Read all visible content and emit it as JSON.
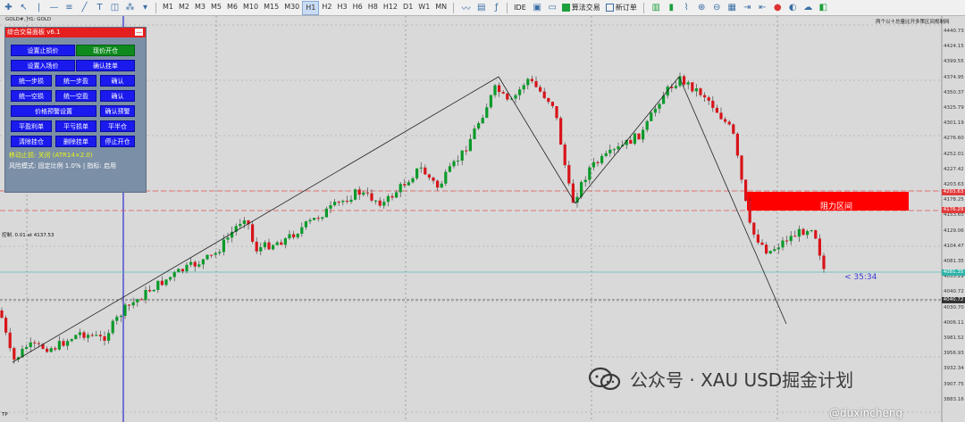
{
  "toolbar": {
    "timeframes": [
      "M1",
      "M2",
      "M3",
      "M5",
      "M6",
      "M10",
      "M15",
      "M30",
      "H1",
      "H2",
      "H3",
      "H6",
      "H8",
      "H12",
      "D1",
      "W1",
      "MN"
    ],
    "active_timeframe": "H1",
    "ide_label": "IDE",
    "algo_label": "算法交易",
    "new_order_label": "新订单"
  },
  "chart": {
    "symbol": "GOLD#, H1: GOLD",
    "top_right_text": "两个以十总量比开多策区间规制网",
    "ctrl_label": "控制. 0.01 at 4137.53",
    "tp_label": "TP",
    "resistance_label": "阻力区间",
    "timer_label": "< 35:34",
    "price_labels": [
      "4440.73",
      "4424.15",
      "4399.55",
      "4374.95",
      "4350.37",
      "4325.79",
      "4301.19",
      "4276.60",
      "4252.01",
      "4227.42",
      "4203.63",
      "4178.25",
      "4153.65",
      "4129.06",
      "4104.47",
      "4081.35",
      "4055.29",
      "4040.72",
      "4030.70",
      "4006.11",
      "3981.52",
      "3956.93",
      "3932.34",
      "3907.75",
      "3883.16"
    ],
    "highlight_price_red_1": "4203.63",
    "highlight_price_red_2": "4176.29",
    "highlight_price_teal": "4081.35",
    "highlight_price_dark": "4040.72",
    "colors": {
      "resistance": "#ff0000",
      "bull": "#0a9a2a",
      "bear": "#d8141a",
      "vline": "#2b2bd0",
      "panel": "#7b8fa6"
    }
  },
  "panel": {
    "title": "综合交易面板 v6.1",
    "close": "—",
    "buttons": [
      {
        "label": "设置止损价",
        "style": "blue"
      },
      {
        "label": "现价开仓",
        "style": "green"
      },
      {
        "label": "设置入场价",
        "style": "blue"
      },
      {
        "label": "确认挂单",
        "style": "blue"
      },
      {
        "label": "统一步损",
        "style": "blue"
      },
      {
        "label": "统一步盈",
        "style": "blue"
      },
      {
        "label": "确认",
        "style": "blue"
      },
      {
        "label": "统一空损",
        "style": "blue"
      },
      {
        "label": "统一空盈",
        "style": "blue"
      },
      {
        "label": "确认",
        "style": "blue"
      },
      {
        "label": "价格预警设置",
        "style": "blue"
      },
      {
        "label": "确认预警",
        "style": "blue"
      },
      {
        "label": "平盈利单",
        "style": "blue"
      },
      {
        "label": "平亏损单",
        "style": "blue"
      },
      {
        "label": "平半仓",
        "style": "blue"
      },
      {
        "label": "清除挂仓",
        "style": "blue"
      },
      {
        "label": "删除挂单",
        "style": "blue"
      },
      {
        "label": "停止开仓",
        "style": "blue"
      }
    ],
    "trailing": "移动止损: 关闭 (ATR14×2.0)",
    "risk": "风险模式: 固定比例 1.0% | 指标: 启用"
  },
  "watermark": {
    "text": "公众号 · XAU USD掘金计划",
    "handle": "@duxincheng"
  }
}
